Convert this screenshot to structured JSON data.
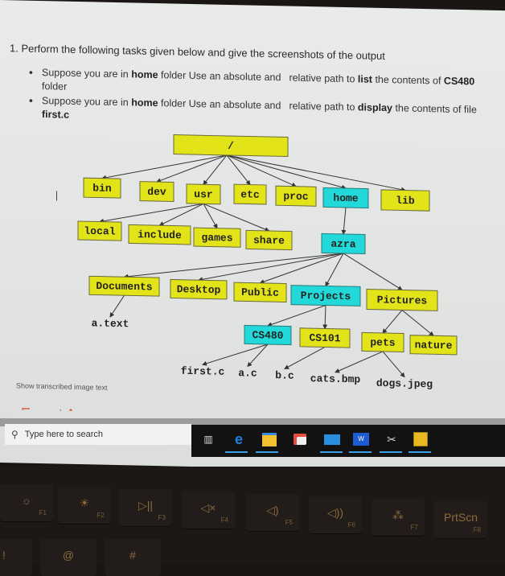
{
  "question": {
    "title": "1. Perform the following tasks given below and give the screenshots of the output",
    "bullets": [
      {
        "p1": "Suppose you are in ",
        "b1": "home",
        "p2": " folder Use an absolute and",
        "p3": "relative path to ",
        "b2": "list",
        "p4": " the contents of ",
        "b3": "CS480",
        "p5": " folder"
      },
      {
        "p1": "Suppose you are in ",
        "b1": "home",
        "p2": " folder Use an absolute and",
        "p3": "relative path to ",
        "b2": "display",
        "p4": " the contents of file ",
        "b3": "first.c",
        "p5": ""
      }
    ]
  },
  "tree": {
    "root": "/",
    "level1": [
      "bin",
      "dev",
      "usr",
      "etc",
      "proc",
      "home",
      "lib"
    ],
    "usr_children": [
      "local",
      "include",
      "games",
      "share"
    ],
    "home_children": [
      "azra"
    ],
    "azra_children": [
      "Documents",
      "Desktop",
      "Public",
      "Projects",
      "Pictures"
    ],
    "documents_children": [
      "a.text"
    ],
    "projects_children": [
      "CS480",
      "CS101"
    ],
    "pictures_children": [
      "pets",
      "nature"
    ],
    "cs480_children": [
      "first.c",
      "a.c"
    ],
    "cs101_children": [
      "b.c"
    ],
    "pets_children": [
      "cats.bmp",
      "dogs.jpeg"
    ],
    "highlight_color": "#22d8d8",
    "node_color": "#e3e31a"
  },
  "show_transcribed": "Show transcribed image text",
  "expert_answer": "Expert Answer",
  "taskbar": {
    "search_placeholder": "Type here to search",
    "apps": [
      "task-view",
      "edge",
      "file-explorer",
      "store",
      "mail",
      "word",
      "paint",
      "sticky-app"
    ]
  },
  "keyboard": {
    "keys": [
      {
        "glyph": "☼",
        "label": "F1"
      },
      {
        "glyph": "☀",
        "label": "F2"
      },
      {
        "glyph": "▷||",
        "label": "F3"
      },
      {
        "glyph": "◁×",
        "label": "F4"
      },
      {
        "glyph": "◁)",
        "label": "F5"
      },
      {
        "glyph": "◁))",
        "label": "F6"
      },
      {
        "glyph": "⁂",
        "label": "F7"
      },
      {
        "glyph": "PrtScn",
        "label": "F8"
      }
    ],
    "row2": [
      "!",
      "@",
      "#"
    ]
  }
}
